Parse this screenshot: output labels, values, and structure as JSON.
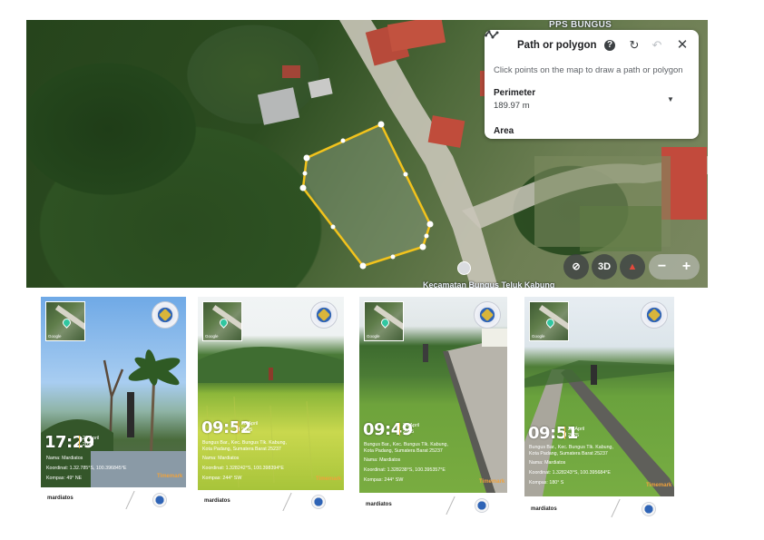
{
  "map": {
    "top_label": "PPS BUNGUS",
    "bottom_label": "Kecamatan Bungus Teluk Kabung",
    "tool": {
      "title": "Path or polygon",
      "hint": "Click points on the map to draw a path or polygon",
      "perimeter_label": "Perimeter",
      "perimeter_value": "189.97 m",
      "area_label": "Area",
      "help_icon": "help-icon",
      "redo_icon": "redo-icon",
      "undo_icon": "undo-icon",
      "close_icon": "close-icon"
    },
    "controls": {
      "tilt": "⊘",
      "three_d": "3D",
      "compass": "▲",
      "zoom_out": "−",
      "zoom_in": "+"
    },
    "polygon_color": "#f2c31c"
  },
  "photos": [
    {
      "time": "17:29",
      "day": "28 April",
      "year": "2025",
      "location": [],
      "name": "Nama: Mardiatos",
      "coords": "Koordinat: 1.32.785°S, 100.396845°E",
      "compass": "Kompas: 49° NE",
      "timemark": "Timemark",
      "author": "mardiatos"
    },
    {
      "time": "09:52",
      "day": "28 April",
      "year": "2025",
      "location": [
        "Bungus Bar., Kec. Bungus Tlk. Kabung,",
        "Kota Padang, Sumatera Barat 25237"
      ],
      "name": "Nama: Mardiatos",
      "coords": "Koordinat: 1.328242°S, 100.398394°E",
      "compass": "Kompas: 244° SW",
      "timemark": "Timemark",
      "author": "mardiatos"
    },
    {
      "time": "09:49",
      "day": "28 April",
      "year": "2025",
      "location": [
        "Bungus Bar., Kec. Bungus Tlk. Kabung,",
        "Kota Padang, Sumatera Barat 25237"
      ],
      "name": "Nama: Mardiatos",
      "coords": "Koordinat: 1.328238°S, 100.395357°E",
      "compass": "Kompas: 244° SW",
      "timemark": "Timemark",
      "author": "mardiatos"
    },
    {
      "time": "09:51",
      "day": "28 April",
      "year": "2025",
      "location": [
        "Bungus Bar., Kec. Bungus Tlk. Kabung,",
        "Kota Padang, Sumatera Barat 25237"
      ],
      "name": "Nama: Mardiatos",
      "coords": "Koordinat: 1.328243°S, 100.395684°E",
      "compass": "Kompas: 180° S",
      "timemark": "Timemark",
      "author": "mardiatos"
    }
  ]
}
